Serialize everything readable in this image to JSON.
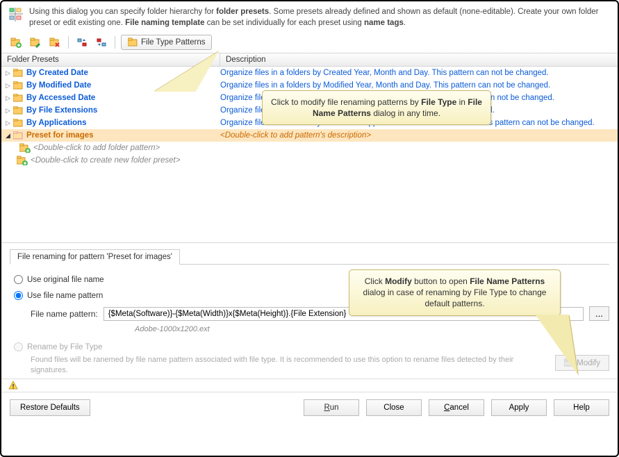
{
  "header": {
    "text_prefix": "Using this dialog you can specify folder hierarchy for ",
    "bold1": "folder presets",
    "text_mid": ". Some presets already defined and shown as default (none-editable). Create your own folder preset or edit existing one. ",
    "bold2": "File naming template",
    "text_mid2": " can be set individually for each preset using ",
    "bold3": "name tags",
    "text_end": "."
  },
  "toolbar": {
    "file_type_patterns": "File Type Patterns"
  },
  "grid": {
    "col1": "Folder Presets",
    "col2": "Description"
  },
  "rows": [
    {
      "label": "By Created Date",
      "desc": "Organize files in a folders by Created Year, Month and Day. This pattern can not be changed."
    },
    {
      "label": "By Modified Date",
      "desc": "Organize files in a folders by Modified Year, Month and Day. This pattern can not be changed."
    },
    {
      "label": "By Accessed Date",
      "desc": "Organize files in a folders by Accessed Year, Month and Day. This pattern can not be changed."
    },
    {
      "label": "By File Extensions",
      "desc": "Organize files in a folders by File Extension. This pattern can not be changed."
    },
    {
      "label": "By Applications",
      "desc": "Organize files in a folders by associated Application and File extensions. This pattern can not be changed."
    }
  ],
  "selected": {
    "label": "Preset for images",
    "desc": "<Double-click to add pattern's description>"
  },
  "placeholders": {
    "add_folder": "<Double-click to add folder pattern>",
    "new_preset": "<Double-click to create new folder preset>"
  },
  "section": {
    "title": "File renaming for pattern 'Preset for images'",
    "opt1": "Use original file name",
    "opt2": "Use file name pattern",
    "pattern_label": "File name pattern:",
    "pattern_value": "{$Meta(Software)}-{$Meta(Width)}x{$Meta(Height)}.{File Extension}",
    "example": "Adobe-1000x1200.ext",
    "opt3": "Rename by File Type",
    "hint": "Found files will be ranemed by file name pattern associated with file type. It is recommended to use this option to rename files detected by their signatures.",
    "modify": "Modify"
  },
  "buttons": {
    "restore": "Restore Defaults",
    "run": "Run",
    "close": "Close",
    "cancel": "Cancel",
    "apply": "Apply",
    "help": "Help"
  },
  "callouts": {
    "c1_p1": "Click to modify file renaming patterns by ",
    "c1_b1": "File Type",
    "c1_p2": " in ",
    "c1_b2": "File Name Patterns",
    "c1_p3": " dialog in any time.",
    "c2_p1": "Click ",
    "c2_b1": "Modify",
    "c2_p2": " button to open ",
    "c2_b2": "File Name Patterns",
    "c2_p3": " dialog in case of renaming by File Type to change default patterns."
  }
}
